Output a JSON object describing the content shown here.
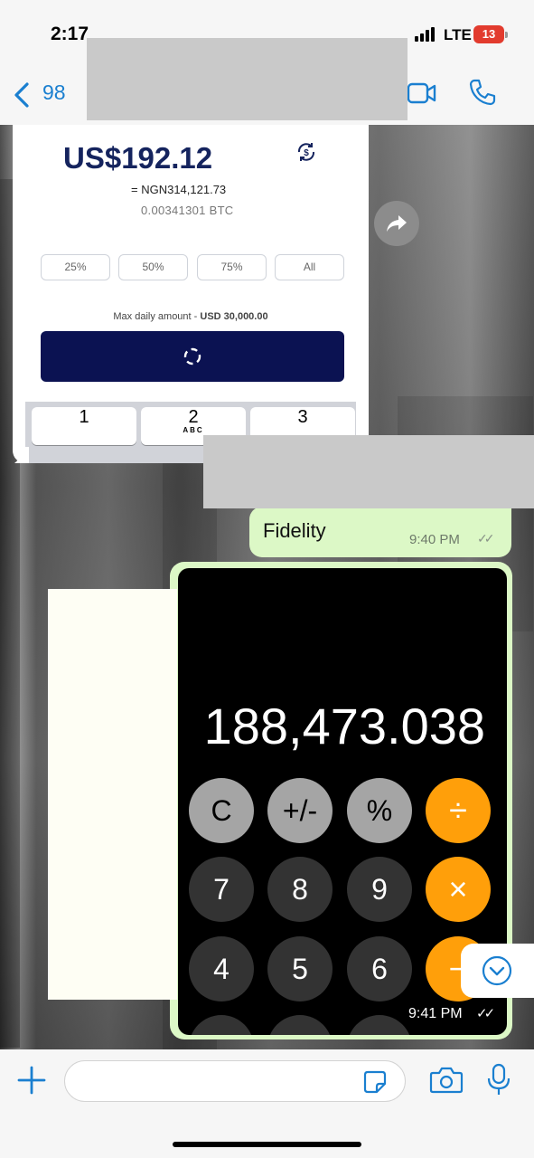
{
  "status_bar": {
    "time": "2:17",
    "network": "LTE",
    "battery": "13"
  },
  "header": {
    "back_count": "98"
  },
  "transaction": {
    "amount": "US$192.12",
    "local_amount": "= NGN314,121.73",
    "btc_amount": "0.00341301 BTC",
    "percent_options": [
      "25%",
      "50%",
      "75%",
      "All"
    ],
    "max_label": "Max daily amount - ",
    "max_value": "USD 30,000.00",
    "keys": [
      {
        "digit": "1",
        "letters": ""
      },
      {
        "digit": "2",
        "letters": "ABC"
      },
      {
        "digit": "3",
        "letters": ""
      }
    ]
  },
  "messages": {
    "fidelity": {
      "text": "Fidelity",
      "time": "9:40 PM"
    },
    "calculator": {
      "display": "188,473.038",
      "time": "9:41 PM",
      "row1": [
        "C",
        "+/-",
        "%",
        "÷"
      ],
      "row2": [
        "7",
        "8",
        "9",
        "×"
      ],
      "row3": [
        "4",
        "5",
        "6",
        "−"
      ]
    }
  },
  "colors": {
    "accent": "#1a7fd0",
    "bubble_out": "#dcf8c6",
    "calc_orange": "#ff9f0a",
    "pay_button": "#0b1252"
  }
}
